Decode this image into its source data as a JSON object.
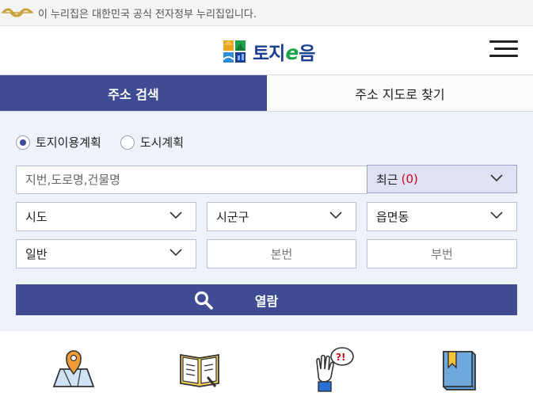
{
  "gov_banner": {
    "text": "이 누리집은 대한민국 공식 전자정부 누리집입니다."
  },
  "header": {
    "brand_name": "토지",
    "brand_e": "e",
    "brand_suffix": "음",
    "menu_icon": "hamburger-menu-icon"
  },
  "tabs": [
    {
      "label": "주소 검색",
      "active": true
    },
    {
      "label": "주소 지도로 찾기",
      "active": false
    }
  ],
  "search": {
    "radio_options": [
      {
        "label": "토지이용계획",
        "checked": true
      },
      {
        "label": "도시계획",
        "checked": false
      }
    ],
    "address_placeholder": "지번,도로명,건물명",
    "address_value": "",
    "recent_label": "최근",
    "recent_count": "(0)",
    "sido_selected": "시도",
    "sigungu_selected": "시군구",
    "eupmyeondong_selected": "읍면동",
    "lot_type_selected": "일반",
    "main_number_placeholder": "본번",
    "sub_number_placeholder": "부번",
    "view_button_label": "열람"
  },
  "quick_menu": [
    {
      "icon": "map-pin-icon"
    },
    {
      "icon": "open-book-icon"
    },
    {
      "icon": "question-hand-icon"
    },
    {
      "icon": "bookmark-book-icon"
    }
  ],
  "colors": {
    "primary": "#3f4c94",
    "panel_bg": "#eef3fb",
    "recent_bg": "#dfe1f4",
    "recent_count": "#d0021b",
    "brand_blue": "#1b3f93",
    "brand_green": "#1ea24a"
  }
}
